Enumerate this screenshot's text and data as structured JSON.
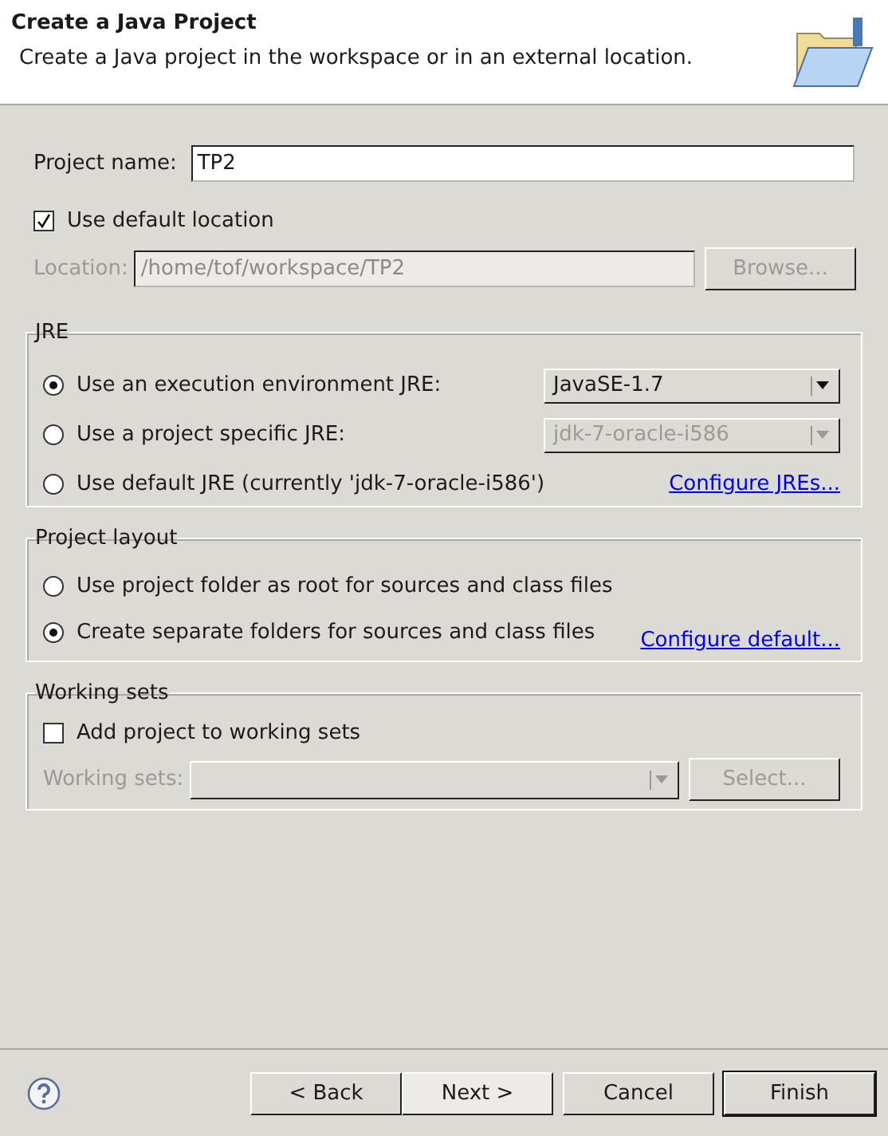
{
  "header": {
    "title": "Create a Java Project",
    "description": "Create a Java project in the workspace or in an external location."
  },
  "project_name": {
    "label": "Project name:",
    "value": "TP2"
  },
  "use_default_location": {
    "label": "Use default location",
    "checked": true
  },
  "location": {
    "label": "Location:",
    "value": "/home/tof/workspace/TP2",
    "disabled": true,
    "button": "Browse..."
  },
  "jre": {
    "title": "JRE",
    "options": [
      {
        "label": "Use an execution environment JRE:",
        "selected": true,
        "control": {
          "kind": "combo",
          "value": "JavaSE-1.7",
          "disabled": false
        }
      },
      {
        "label": "Use a project specific JRE:",
        "selected": false,
        "control": {
          "kind": "combo",
          "value": "jdk-7-oracle-i586",
          "disabled": true
        }
      },
      {
        "label": "Use default JRE (currently 'jdk-7-oracle-i586')",
        "selected": false,
        "control": {
          "kind": "link",
          "text": "Configure JREs..."
        }
      }
    ]
  },
  "project_layout": {
    "title": "Project layout",
    "options": [
      {
        "label": "Use project folder as root for sources and class files",
        "selected": false
      },
      {
        "label": "Create separate folders for sources and class files",
        "selected": true
      }
    ],
    "link": "Configure default..."
  },
  "working_sets": {
    "title": "Working sets",
    "checkbox": {
      "label": "Add project to working sets",
      "checked": false
    },
    "field": {
      "label": "Working sets:",
      "disabled": true
    },
    "button": "Select..."
  },
  "buttons": [
    {
      "label": "< Back",
      "highlighted": false,
      "default": false
    },
    {
      "label": "Next >",
      "highlighted": true,
      "default": false
    },
    {
      "label": "Cancel",
      "highlighted": false,
      "default": false
    },
    {
      "label": "Finish",
      "highlighted": false,
      "default": true
    }
  ]
}
